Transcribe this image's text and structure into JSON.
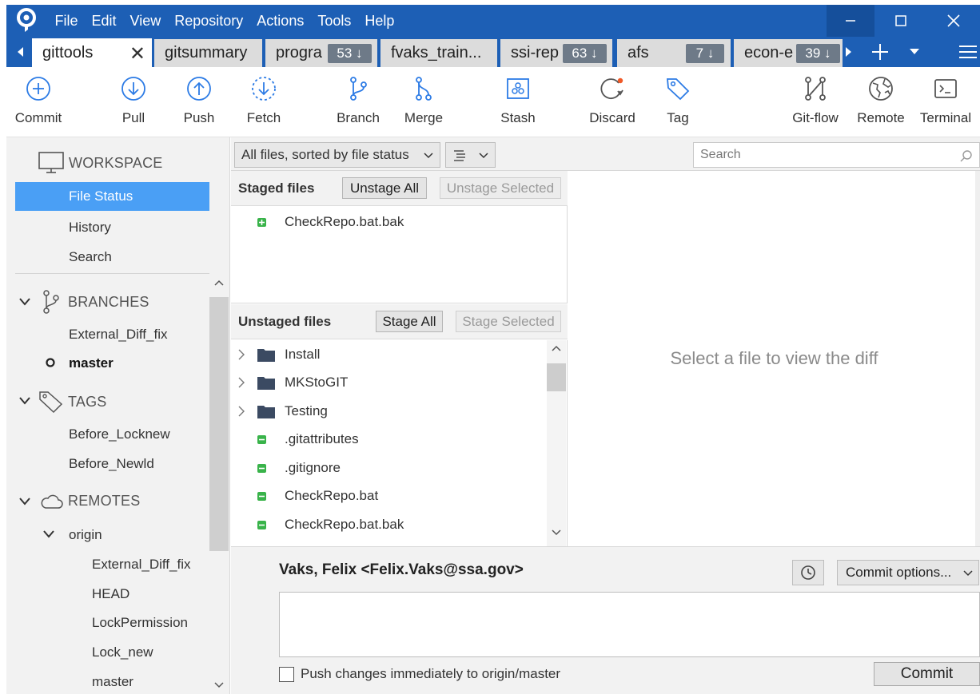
{
  "menu": [
    "File",
    "Edit",
    "View",
    "Repository",
    "Actions",
    "Tools",
    "Help"
  ],
  "tabs": [
    {
      "label": "gittools",
      "active": true
    },
    {
      "label": "gitsummary"
    },
    {
      "label": "progra",
      "badge": "53 ↓"
    },
    {
      "label": "fvaks_train..."
    },
    {
      "label": "ssi-rep",
      "badge": "63 ↓"
    },
    {
      "label": "afs",
      "badge": "7 ↓"
    },
    {
      "label": "econ-e",
      "badge": "39 ↓"
    }
  ],
  "toolbar": {
    "commit": "Commit",
    "pull": "Pull",
    "push": "Push",
    "fetch": "Fetch",
    "branch": "Branch",
    "merge": "Merge",
    "stash": "Stash",
    "discard": "Discard",
    "tag": "Tag",
    "gitflow": "Git-flow",
    "remote": "Remote",
    "terminal": "Terminal"
  },
  "sidebar": {
    "workspace": "WORKSPACE",
    "workspace_items": [
      "File Status",
      "History",
      "Search"
    ],
    "branches": "BRANCHES",
    "branch_items": [
      "External_Diff_fix",
      "master"
    ],
    "tags": "TAGS",
    "tag_items": [
      "Before_Locknew",
      "Before_Newld"
    ],
    "remotes": "REMOTES",
    "remote_name": "origin",
    "remote_items": [
      "External_Diff_fix",
      "HEAD",
      "LockPermission",
      "Lock_new",
      "master"
    ]
  },
  "filter": {
    "sort_label": "All files, sorted by file status",
    "search_placeholder": "Search"
  },
  "staged": {
    "title": "Staged files",
    "unstage_all": "Unstage All",
    "unstage_selected": "Unstage Selected",
    "files": [
      "CheckRepo.bat.bak"
    ]
  },
  "unstaged": {
    "title": "Unstaged files",
    "stage_all": "Stage All",
    "stage_selected": "Stage Selected",
    "folders": [
      "Install",
      "MKStoGIT",
      "Testing"
    ],
    "files": [
      ".gitattributes",
      ".gitignore",
      "CheckRepo.bat",
      "CheckRepo.bat.bak"
    ]
  },
  "diff": {
    "placeholder": "Select a file to view the diff"
  },
  "commit": {
    "author": "Vaks, Felix <Felix.Vaks@ssa.gov>",
    "options": "Commit options...",
    "push_label": "Push changes immediately to origin/master",
    "button": "Commit"
  },
  "colors": {
    "accent": "#1d5fb5",
    "selection": "#4a9ff5",
    "added": "#39b34a"
  }
}
